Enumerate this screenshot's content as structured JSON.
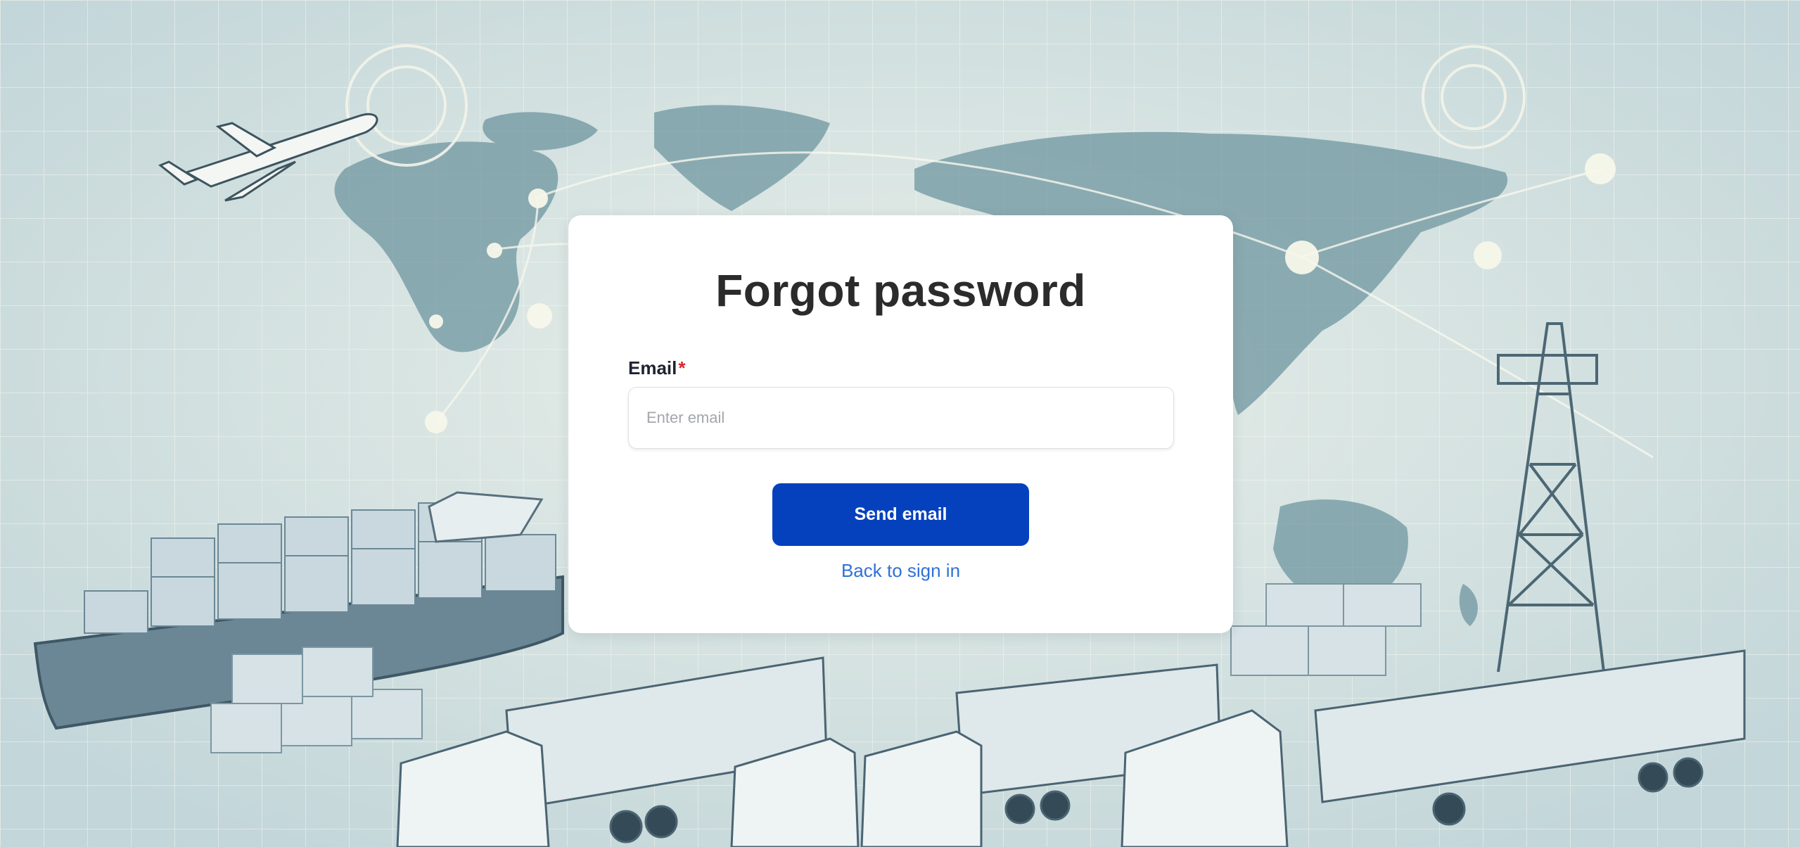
{
  "colors": {
    "primary_button": "#0641bd",
    "link": "#2f71d8",
    "required_marker": "#e0202c",
    "title_text": "#2b2b2b",
    "card_background": "#ffffff"
  },
  "background": {
    "scene": "logistics illustration",
    "icons": [
      "world-map",
      "airplane",
      "cargo-ship",
      "container-trucks",
      "radio-tower",
      "compass-rose"
    ]
  },
  "form": {
    "title": "Forgot password",
    "email": {
      "label": "Email",
      "required_marker": "*",
      "value": "",
      "placeholder": "Enter email"
    },
    "send_button_label": "Send email",
    "back_link_label": "Back to sign in"
  }
}
